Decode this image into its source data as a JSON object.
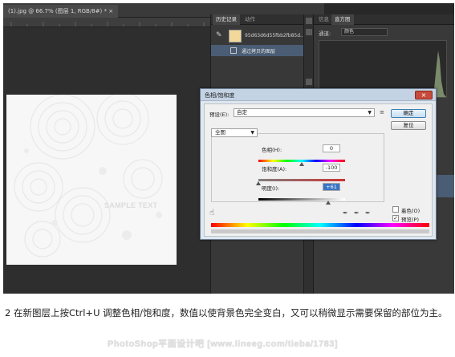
{
  "document_tab": {
    "title": "(1).jpg @ 66.7% (图层 1, RGB/8#) * ×"
  },
  "canvas": {
    "sample_text": "SAMPLE TEXT"
  },
  "history_panel": {
    "tabs": [
      "历史记录",
      "动作"
    ],
    "items": [
      {
        "label": "95d63d6d55fbb2fb85d..."
      },
      {
        "label": "通过拷贝的图层"
      }
    ]
  },
  "histogram_panel": {
    "tabs": [
      "信息",
      "直方图"
    ],
    "channel_label": "通道:",
    "channel_value": "颜色"
  },
  "dialog": {
    "title": "色相/饱和度",
    "close_label": "×",
    "preset_label": "预设(E):",
    "preset_value": "自定",
    "ok_label": "确定",
    "reset_label": "复位",
    "channel_value": "全图",
    "hue": {
      "label": "色相(H):",
      "value": "0",
      "fraction": 0.5
    },
    "saturation": {
      "label": "饱和度(A):",
      "value": "-100",
      "fraction": 0.0
    },
    "lightness": {
      "label": "明度(I):",
      "value": "+61",
      "fraction": 0.805
    },
    "colorize_label": "着色(O)",
    "preview_label": "预览(P)",
    "colorize_checked": false,
    "preview_checked": true
  },
  "caption": "2 在新图层上按Ctrl+U 调整色相/饱和度，数值以使背景色完全变白，又可以稍微显示需要保留的部位为主。",
  "watermark": "PhotoShop平面设计吧 [www.lineeg.com/tieba/1783]"
}
